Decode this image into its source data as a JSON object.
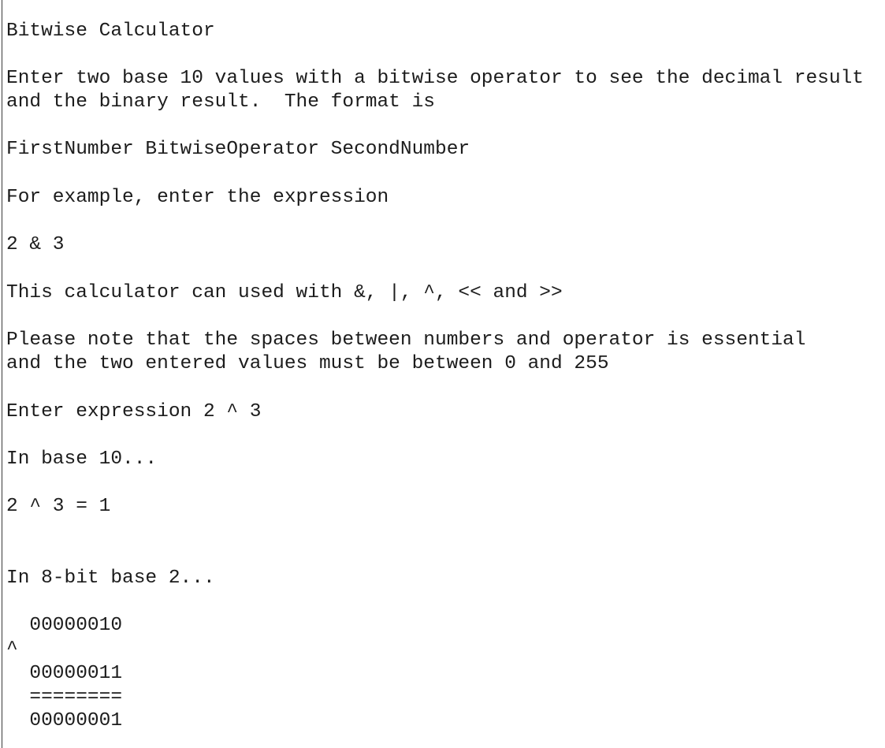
{
  "app": {
    "title": "Bitwise Calculator",
    "kind": "terminal-console-output",
    "background_color": "#ffffff",
    "text_color": "#1c1c1c",
    "rule_color": "#3a3a3a"
  },
  "console": {
    "heading": "Bitwise Calculator",
    "lines": [
      {
        "id": "heading",
        "text": "Bitwise Calculator"
      },
      {
        "id": "blank-1",
        "text": ""
      },
      {
        "id": "intro-1",
        "text": "Enter two base 10 values with a bitwise operator to see the decimal result"
      },
      {
        "id": "intro-2",
        "text": "and the binary result.  The format is"
      },
      {
        "id": "blank-2",
        "text": ""
      },
      {
        "id": "format",
        "text": "FirstNumber BitwiseOperator SecondNumber"
      },
      {
        "id": "blank-3",
        "text": ""
      },
      {
        "id": "example-label",
        "text": "For example, enter the expression"
      },
      {
        "id": "blank-4",
        "text": ""
      },
      {
        "id": "example-expr",
        "text": "2 & 3"
      },
      {
        "id": "blank-5",
        "text": ""
      },
      {
        "id": "operators",
        "text": "This calculator can used with &, |, ^, << and >>"
      },
      {
        "id": "blank-6",
        "text": ""
      },
      {
        "id": "note-1",
        "text": "Please note that the spaces between numbers and operator is essential"
      },
      {
        "id": "note-2",
        "text": "and the two entered values must be between 0 and 255"
      },
      {
        "id": "blank-7",
        "text": ""
      },
      {
        "id": "prompt",
        "text": "Enter expression 2 ^ 3"
      },
      {
        "id": "blank-8",
        "text": ""
      },
      {
        "id": "base10-label",
        "text": "In base 10..."
      },
      {
        "id": "blank-9",
        "text": ""
      },
      {
        "id": "base10-result",
        "text": "2 ^ 3 = 1"
      },
      {
        "id": "blank-10",
        "text": ""
      },
      {
        "id": "blank-11",
        "text": ""
      },
      {
        "id": "base2-label",
        "text": "In 8-bit base 2..."
      },
      {
        "id": "blank-12",
        "text": ""
      },
      {
        "id": "binary-operand-1",
        "text": "  00000010"
      },
      {
        "id": "binary-operator",
        "text": "^"
      },
      {
        "id": "binary-operand-2",
        "text": "  00000011"
      },
      {
        "id": "binary-divider",
        "text": "  ========"
      },
      {
        "id": "binary-result",
        "text": "  00000001"
      }
    ]
  },
  "session": {
    "entered_expression": "2 ^ 3",
    "first_number": "2",
    "bitwise_operator": "^",
    "second_number": "3",
    "decimal_result": "1",
    "binary_first_number": "00000010",
    "binary_second_number": "00000011",
    "binary_result": "00000001",
    "supported_operators": [
      "&",
      "|",
      "^",
      "<<",
      ">>"
    ],
    "min_value": "0",
    "max_value": "255",
    "bit_width": "8"
  }
}
